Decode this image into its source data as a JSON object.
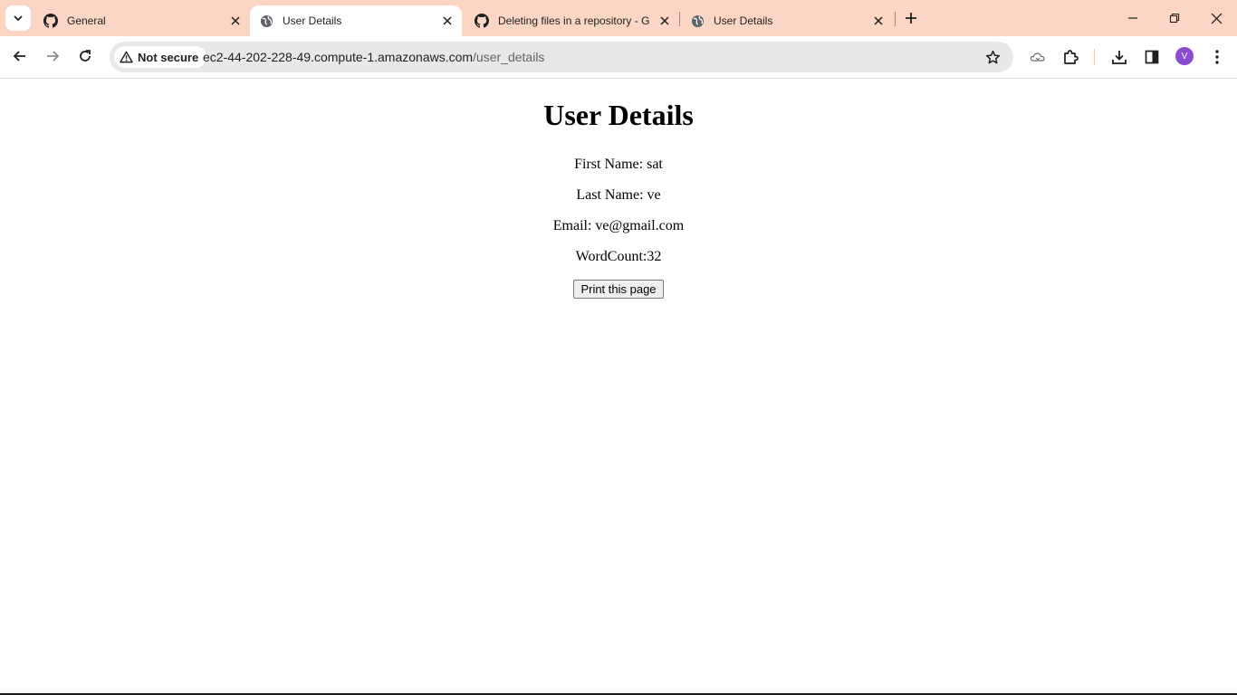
{
  "tabs": [
    {
      "title": "General",
      "icon": "github-icon",
      "active": false
    },
    {
      "title": "User Details",
      "icon": "globe-icon",
      "active": true
    },
    {
      "title": "Deleting files in a repository - G",
      "icon": "github-icon",
      "active": false
    },
    {
      "title": "User Details",
      "icon": "globe-icon",
      "active": false
    }
  ],
  "address_bar": {
    "security_label": "Not secure",
    "url_host": "ec2-44-202-228-49.compute-1.amazonaws.com",
    "url_path": "/user_details"
  },
  "profile": {
    "initial": "V",
    "color": "#8a4bd0"
  },
  "page": {
    "heading": "User Details",
    "first_name": "First Name: sat",
    "last_name": "Last Name: ve",
    "email": "Email: ve@gmail.com",
    "word_count": "WordCount:32",
    "print_button": "Print this page"
  },
  "colors": {
    "tabstrip": "#fbd6c4",
    "accent": "#8a4bd0"
  }
}
